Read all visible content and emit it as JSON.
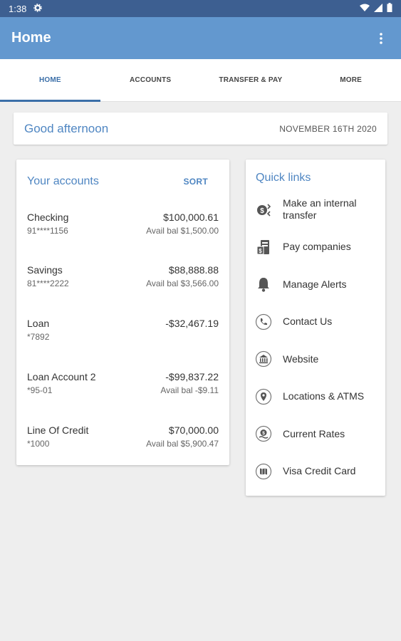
{
  "status": {
    "time": "1:38"
  },
  "app_bar": {
    "title": "Home"
  },
  "tabs": [
    {
      "label": "HOME"
    },
    {
      "label": "ACCOUNTS"
    },
    {
      "label": "TRANSFER & PAY"
    },
    {
      "label": "MORE"
    }
  ],
  "greeting": {
    "text": "Good afternoon",
    "date": "NOVEMBER 16TH 2020"
  },
  "accounts": {
    "title": "Your accounts",
    "sort_label": "SORT",
    "items": [
      {
        "name": "Checking",
        "number": "91****1156",
        "balance": "$100,000.61",
        "avail": "Avail bal $1,500.00"
      },
      {
        "name": "Savings",
        "number": "81****2222",
        "balance": "$88,888.88",
        "avail": "Avail bal $3,566.00"
      },
      {
        "name": "Loan",
        "number": "*7892",
        "balance": "-$32,467.19",
        "avail": ""
      },
      {
        "name": "Loan Account 2",
        "number": "*95-01",
        "balance": "-$99,837.22",
        "avail": "Avail bal -$9.11"
      },
      {
        "name": "Line Of Credit",
        "number": "*1000",
        "balance": "$70,000.00",
        "avail": "Avail bal $5,900.47"
      }
    ]
  },
  "quick_links": {
    "title": "Quick links",
    "items": [
      {
        "label": "Make an internal transfer",
        "icon": "transfer-icon"
      },
      {
        "label": "Pay companies",
        "icon": "bill-icon"
      },
      {
        "label": "Manage Alerts",
        "icon": "bell-icon"
      },
      {
        "label": "Contact Us",
        "icon": "phone-icon"
      },
      {
        "label": "Website",
        "icon": "bank-icon"
      },
      {
        "label": "Locations & ATMS",
        "icon": "location-icon"
      },
      {
        "label": "Current Rates",
        "icon": "rates-icon"
      },
      {
        "label": "Visa Credit Card",
        "icon": "card-icon"
      }
    ]
  },
  "colors": {
    "app_bar": "#6398cf",
    "status_bar": "#3d5f91",
    "accent": "#4f86c2",
    "active_tab": "#3b6fa8"
  }
}
